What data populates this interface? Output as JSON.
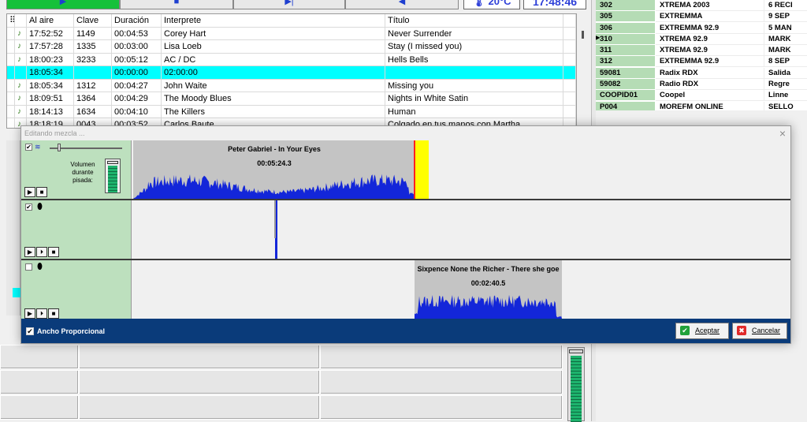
{
  "transport": {
    "play_glyph": "▶",
    "stop_glyph": "■",
    "next_glyph": "▶|",
    "prev_glyph": "◀",
    "temperature": "🌡 20°C",
    "clock": "17:48:46"
  },
  "playlist": {
    "headers": [
      "",
      "",
      "Al aire",
      "Clave",
      "Duración",
      "Interprete",
      "Título",
      ""
    ],
    "rows": [
      {
        "time": "17:52:52",
        "clave": "1149",
        "dur": "00:04:53",
        "artist": "Corey Hart",
        "title": "Never Surrender"
      },
      {
        "time": "17:57:28",
        "clave": "1335",
        "dur": "00:03:00",
        "artist": "Lisa Loeb",
        "title": "Stay (I missed you)"
      },
      {
        "time": "18:00:23",
        "clave": "3233",
        "dur": "00:05:12",
        "artist": "AC / DC",
        "title": "Hells Bells"
      },
      {
        "time": "18:05:34",
        "clave": "",
        "dur": "00:00:00",
        "artist": "02:00:00",
        "title": ""
      },
      {
        "time": "18:05:34",
        "clave": "1312",
        "dur": "00:04:27",
        "artist": "John Waite",
        "title": "Missing you"
      },
      {
        "time": "18:09:51",
        "clave": "1364",
        "dur": "00:04:29",
        "artist": "The Moody Blues",
        "title": "Nights in White Satin"
      },
      {
        "time": "18:14:13",
        "clave": "1634",
        "dur": "00:04:10",
        "artist": "The Killers",
        "title": "Human"
      },
      {
        "time": "18:18:19",
        "clave": "0043",
        "dur": "00:03:52",
        "artist": "Carlos Baute",
        "title": "Colgado en tus manos con Martha"
      }
    ],
    "note_icon": "♪"
  },
  "stations": [
    {
      "code": "302",
      "name": "XTREMA 2003",
      "extra": "6 RECI"
    },
    {
      "code": "305",
      "name": "EXTREMMA",
      "extra": "9 SEP"
    },
    {
      "code": "306",
      "name": "EXTREMMA 92.9",
      "extra": "5 MAN"
    },
    {
      "code": "310",
      "name": "XTREMA 92.9",
      "extra": "MARK"
    },
    {
      "code": "311",
      "name": "XTREMA 92.9",
      "extra": "MARK"
    },
    {
      "code": "312",
      "name": "EXTREMMA 92.9",
      "extra": "8 SEP"
    },
    {
      "code": "59081",
      "name": "Radix RDX",
      "extra": "Salida"
    },
    {
      "code": "59082",
      "name": "Radio RDX",
      "extra": "Regre"
    },
    {
      "code": "COOPID01",
      "name": "Coopel",
      "extra": "Linne"
    },
    {
      "code": "P004",
      "name": "MOREFM ONLINE",
      "extra": "SELLO"
    }
  ],
  "dialog": {
    "title": "Editando mezcla ...",
    "close": "×",
    "track1": {
      "clip_title": "Peter Gabriel - In Your Eyes",
      "clip_time": "00:05:24.3",
      "vol_label": "Volumen durante pisada:",
      "checked": "✔"
    },
    "track2": {
      "checked": "✔"
    },
    "track3": {
      "clip_title": "Sixpence None the Richer - There she goe",
      "clip_time": "00:02:40.5",
      "checked": ""
    },
    "ancho_label": "Ancho Proporcional",
    "ancho_checked": "✔",
    "ok_label": "Aceptar",
    "cancel_label": "Cancelar",
    "ok_icon": "✔",
    "cancel_icon": "✖"
  },
  "colors": {
    "accent_cyan": "#00ffff",
    "dialog_footer": "#0a3b7a",
    "waveform": "#1326d9",
    "play_green": "#16c13a"
  }
}
